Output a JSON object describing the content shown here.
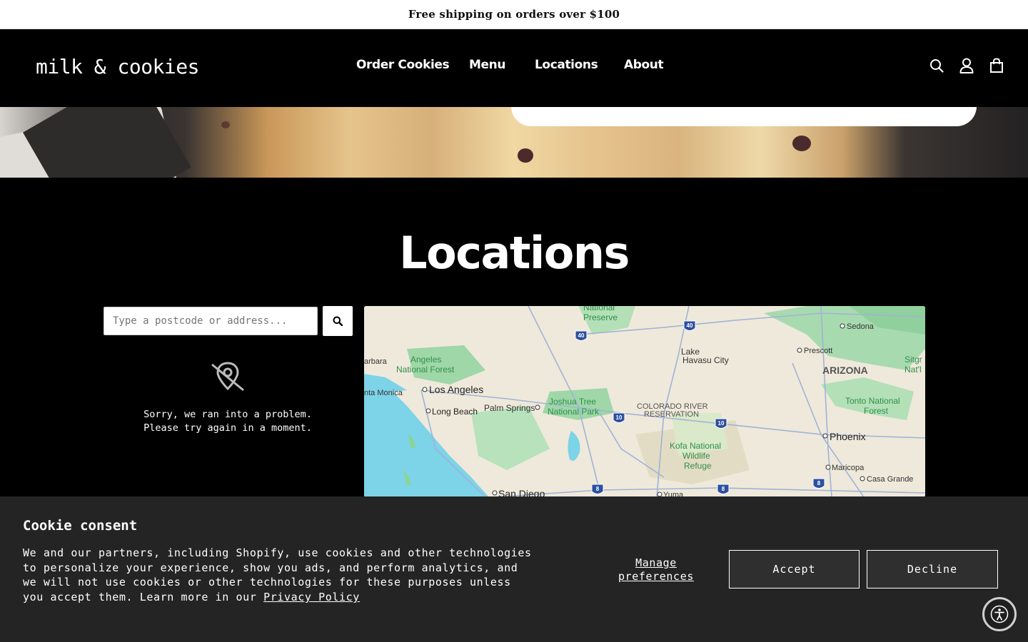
{
  "announcement": "Free shipping on orders over $100",
  "brand": {
    "logo_text": "milk & cookies"
  },
  "nav": {
    "items": [
      {
        "label": "Order Cookies"
      },
      {
        "label": "Menu"
      },
      {
        "label": "Locations"
      },
      {
        "label": "About"
      }
    ]
  },
  "header_icons": [
    "search-icon",
    "account-icon",
    "cart-icon"
  ],
  "page": {
    "title": "Locations"
  },
  "locator": {
    "search_placeholder": "Type a postcode or address...",
    "error_line1": "Sorry, we ran into a problem.",
    "error_line2": "Please try again in a moment."
  },
  "map": {
    "labels": {
      "preserve": "National\nPreserve",
      "angeles": "Angeles",
      "angeles_nf": "National Forest",
      "barbara": "arbara",
      "santa_monica": "nta Monica",
      "los_angeles": "Los Angeles",
      "long_beach": "Long Beach",
      "palm_springs": "Palm Springs",
      "joshua_tree": "Joshua Tree",
      "joshua_tree_np": "National Park",
      "colorado_river": "COLORADO RIVER",
      "reservation": "RESERVATION",
      "lake": "Lake",
      "havasu": "Havasu City",
      "kofa1": "Kofa National",
      "kofa2": "Wildlife",
      "kofa3": "Refuge",
      "sedona": "Sedona",
      "prescott": "Prescott",
      "arizona": "ARIZONA",
      "sitgr": "Sitgr",
      "natl": "Nat'l",
      "tonto1": "Tonto National",
      "tonto2": "Forest",
      "phoenix": "Phoenix",
      "maricopa": "Maricopa",
      "casa_grande": "Casa Grande",
      "san_diego": "San Diego",
      "yuma": "Yuma"
    },
    "shields": [
      "40",
      "40",
      "10",
      "10",
      "8",
      "8",
      "8"
    ]
  },
  "cookie": {
    "title": "Cookie consent",
    "body": "We and our partners, including Shopify, use cookies and other technologies to personalize your experience, show you ads, and perform analytics, and we will not use cookies or other technologies for these purposes unless you accept them. Learn more in our ",
    "privacy_link": "Privacy Policy",
    "manage_label": "Manage preferences",
    "accept_label": "Accept",
    "decline_label": "Decline"
  },
  "colors": {
    "water": "#7dd3e8",
    "land": "#efe9db",
    "park": "#9fd7a8",
    "road": "#8aa0c8"
  }
}
